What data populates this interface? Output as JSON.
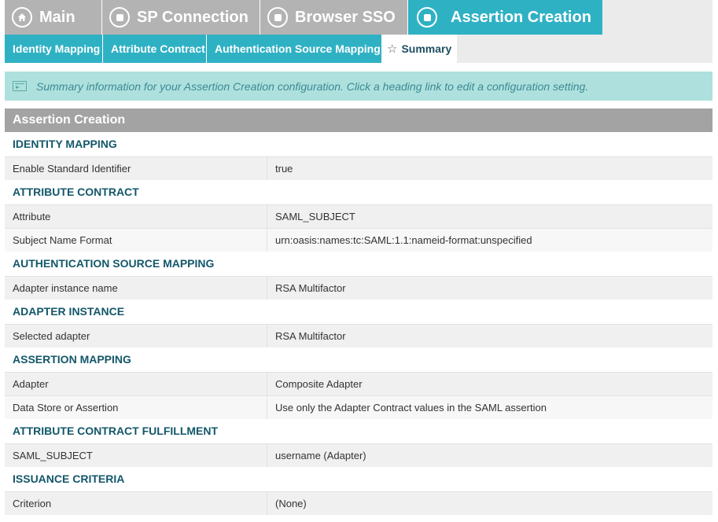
{
  "top_tabs": [
    {
      "label": "Main",
      "icon": "home-icon",
      "active": false
    },
    {
      "label": "SP Connection",
      "icon": "circle-square-icon",
      "active": false
    },
    {
      "label": "Browser SSO",
      "icon": "circle-square-icon",
      "active": false
    },
    {
      "label": "Assertion Creation",
      "icon": "circle-square-icon",
      "active": true
    }
  ],
  "sub_tabs": [
    {
      "label": "Identity Mapping",
      "active": false
    },
    {
      "label": "Attribute Contract",
      "active": false
    },
    {
      "label": "Authentication Source Mapping",
      "active": false
    },
    {
      "label": "Summary",
      "icon": "star-icon",
      "active": true
    }
  ],
  "info": {
    "text": "Summary information for your Assertion Creation configuration. Click a heading link to edit a configuration setting.",
    "icon": "info-panel-icon"
  },
  "panel": {
    "title": "Assertion Creation",
    "sections": [
      {
        "heading": "IDENTITY MAPPING",
        "rows": [
          {
            "label": "Enable Standard Identifier",
            "value": "true"
          }
        ]
      },
      {
        "heading": "ATTRIBUTE CONTRACT",
        "rows": [
          {
            "label": "Attribute",
            "value": "SAML_SUBJECT"
          },
          {
            "label": "Subject Name Format",
            "value": "urn:oasis:names:tc:SAML:1.1:nameid-format:unspecified"
          }
        ]
      },
      {
        "heading": "AUTHENTICATION SOURCE MAPPING",
        "rows": [
          {
            "label": "Adapter instance name",
            "value": "RSA Multifactor"
          }
        ]
      },
      {
        "heading": "ADAPTER INSTANCE",
        "rows": [
          {
            "label": "Selected adapter",
            "value": "RSA Multifactor"
          }
        ]
      },
      {
        "heading": "ASSERTION MAPPING",
        "rows": [
          {
            "label": "Adapter",
            "value": "Composite Adapter"
          },
          {
            "label": "Data Store or Assertion",
            "value": "Use only the Adapter Contract values in the SAML assertion"
          }
        ]
      },
      {
        "heading": "ATTRIBUTE CONTRACT FULFILLMENT",
        "rows": [
          {
            "label": "SAML_SUBJECT",
            "value": "username (Adapter)"
          }
        ]
      },
      {
        "heading": "ISSUANCE CRITERIA",
        "rows": [
          {
            "label": "Criterion",
            "value": "(None)"
          }
        ]
      }
    ]
  },
  "colors": {
    "accent": "#2fb1c4",
    "inactive_tab": "#b3b3b3",
    "heading_text": "#13576a",
    "info_bg": "#aee1dd",
    "panel_header": "#a3a3a3"
  }
}
